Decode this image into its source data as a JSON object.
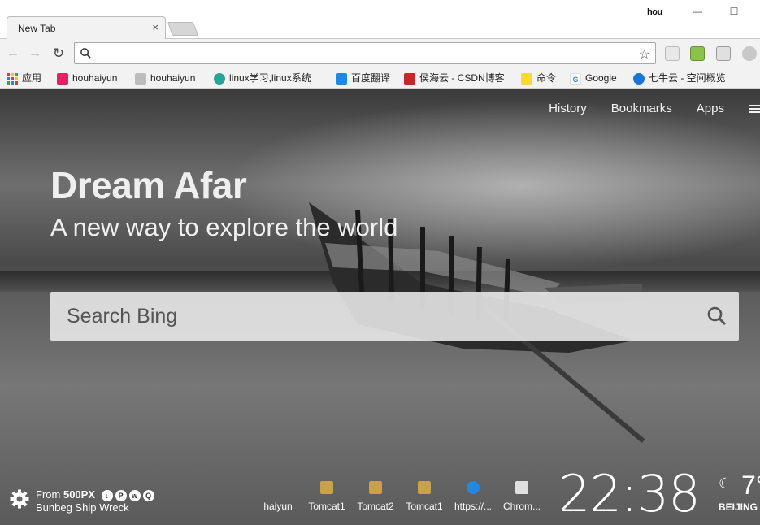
{
  "browser": {
    "tab_title": "New Tab",
    "tab_close": "×",
    "profile_name": "hou",
    "window_min": "—",
    "window_max": "☐",
    "omnibox_value": ""
  },
  "bookmarks": [
    {
      "label": "应用",
      "icon": "apps-grid-icon",
      "color": "#e53935"
    },
    {
      "label": "houhaiyun",
      "icon": "bookmark-icon",
      "color": "#e91e63"
    },
    {
      "label": "houhaiyun",
      "icon": "bookmark-icon",
      "color": "#9e9e9e"
    },
    {
      "label": "linux学习,linux系统",
      "icon": "bookmark-icon",
      "color": "#26a69a"
    },
    {
      "label": "百度翻译",
      "icon": "translate-icon",
      "color": "#1e88e5"
    },
    {
      "label": "侯海云 - CSDN博客",
      "icon": "csdn-icon",
      "color": "#c62828"
    },
    {
      "label": "命令",
      "icon": "folder-icon",
      "color": "#fdd835"
    },
    {
      "label": "Google",
      "icon": "google-icon",
      "color": "#4285f4"
    },
    {
      "label": "七牛云 - 空间概览",
      "icon": "qiniu-icon",
      "color": "#1976d2"
    }
  ],
  "nav": {
    "history": "History",
    "bookmarks": "Bookmarks",
    "apps": "Apps"
  },
  "hero": {
    "title": "Dream Afar",
    "subtitle": "A new way to explore the world"
  },
  "search": {
    "placeholder": "Search Bing"
  },
  "photo_credit": {
    "from_prefix": "From",
    "source": "500PX",
    "title": "Bunbeg Ship Wreck",
    "social_icons": [
      "download-icon",
      "pinterest-icon",
      "weibo-icon",
      "qq-icon"
    ]
  },
  "dock": [
    {
      "label": "haiyun",
      "icon": "site-icon",
      "color": "rgba(0,0,0,0)"
    },
    {
      "label": "Tomcat1",
      "icon": "tomcat-icon",
      "color": "#c9a14a"
    },
    {
      "label": "Tomcat2",
      "icon": "tomcat-icon",
      "color": "#c9a14a"
    },
    {
      "label": "Tomcat1",
      "icon": "tomcat-icon",
      "color": "#c9a14a"
    },
    {
      "label": "https://...",
      "icon": "qiniu-icon",
      "color": "#1e88e5"
    },
    {
      "label": "Chrom...",
      "icon": "chrome-icon",
      "color": "#e0e0e0"
    }
  ],
  "clock": {
    "time": "22:38"
  },
  "weather": {
    "icon": "moon-icon",
    "temp": "7°",
    "city": "BEIJING"
  }
}
